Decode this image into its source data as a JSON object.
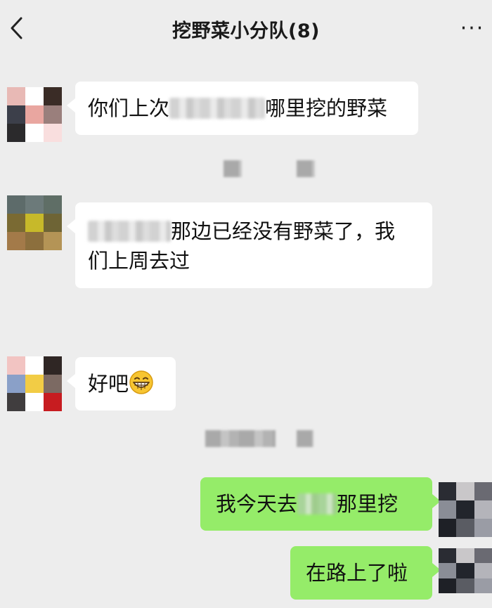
{
  "header": {
    "back_icon": "chevron-left-icon",
    "title": "挖野菜小分队(8)",
    "more_icon": "ellipsis-icon",
    "more_label": "···"
  },
  "messages": [
    {
      "side": "left",
      "text_before": "你们上次",
      "text_after": "哪里挖的野菜"
    },
    {
      "side": "left",
      "text_before": "",
      "text_after_line1": "那边已经没有野菜了，我",
      "text_line2": "们上周去过"
    },
    {
      "side": "left",
      "text": "好吧",
      "emoji": "grinning-face-emoji"
    },
    {
      "side": "right",
      "text_before": "我今天去",
      "text_after": "那里挖"
    },
    {
      "side": "right",
      "text": "在路上了啦"
    }
  ],
  "colors": {
    "background": "#ededed",
    "incoming_bubble": "#ffffff",
    "outgoing_bubble": "#95ec69"
  }
}
